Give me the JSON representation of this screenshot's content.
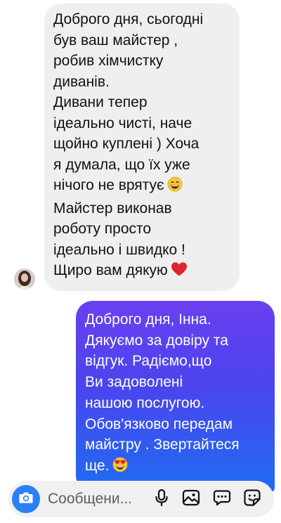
{
  "incoming": {
    "lines": [
      "Доброго дня, сьогодні",
      "був ваш майстер ,",
      "робив хімчистку",
      "диванів.",
      "Дивани тепер",
      "ідеально чисті, наче",
      "щойно куплені ) Хоча",
      "я думала, що їх уже",
      "нічого не врятує",
      "Майстер виконав",
      "роботу просто",
      "ідеально і швидко !",
      "Щиро вам дякую"
    ]
  },
  "outgoing": {
    "lines": [
      "Доброго дня, Інна.",
      "Дякуємо за довіру та",
      "відгук. Радіємо,що",
      "Ви задоволені",
      "нашою послугою.",
      "Обов'язково передам",
      "майстру . Звертайтеся",
      "ще."
    ]
  },
  "composer": {
    "placeholder": "Сообщени..."
  },
  "icons": {
    "camera": "camera-icon",
    "mic": "microphone-icon",
    "gallery": "image-gallery-icon",
    "chat": "chat-bubble-icon",
    "sticker": "sticker-icon",
    "grin_emoji": "grinning-face-emoji",
    "heart_emoji": "red-heart-emoji",
    "hearts_eyes_emoji": "heart-eyes-emoji"
  },
  "colors": {
    "incoming_bubble": "#efefef",
    "outgoing_gradient_top": "#6a3ff0",
    "outgoing_gradient_bottom": "#1f6cf2",
    "camera_button": "#2d7ff5"
  }
}
